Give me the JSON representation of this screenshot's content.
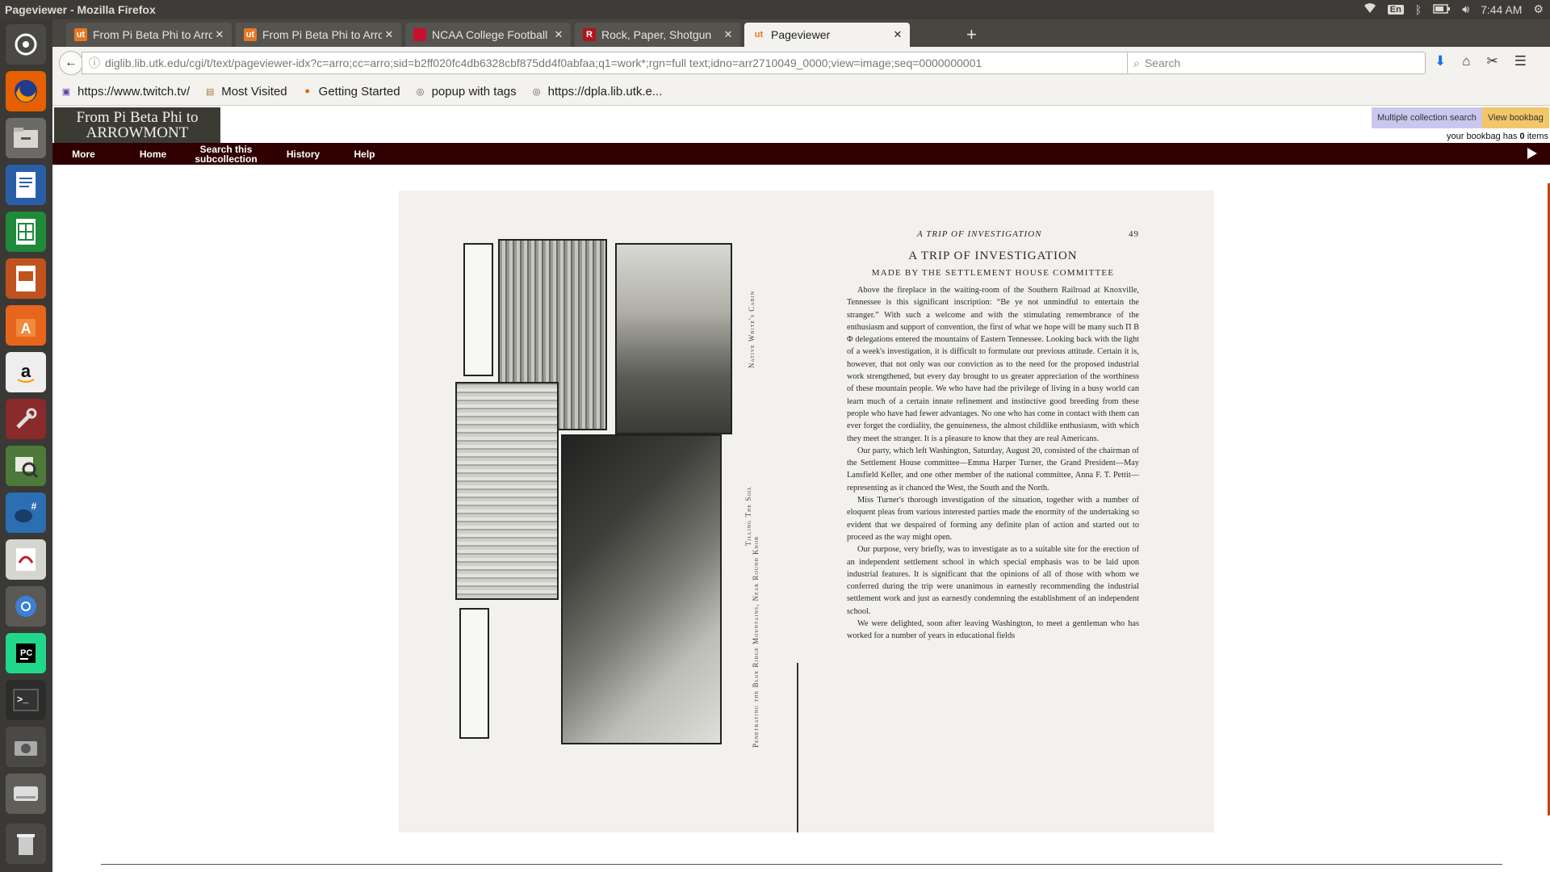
{
  "system": {
    "window_title": "Pageviewer - Mozilla Firefox",
    "keyboard": "En",
    "clock": "7:44 AM"
  },
  "browser": {
    "tabs": [
      {
        "label": "From Pi Beta Phi to Arrowmont",
        "icon": "ut-favicon"
      },
      {
        "label": "From Pi Beta Phi to Arrowmont",
        "icon": "ut-favicon"
      },
      {
        "label": "NCAA College Football",
        "icon": "ncaa-favicon"
      },
      {
        "label": "Rock, Paper, Shotgun",
        "icon": "rps-favicon"
      },
      {
        "label": "Pageviewer",
        "icon": "ut-favicon",
        "active": true
      }
    ],
    "url": "diglib.lib.utk.edu/cgi/t/text/pageviewer-idx?c=arro;cc=arro;sid=b2ff020fc4db6328cbf875dd4f0abfaa;q1=work*;rgn=full text;idno=arr2710049_0000;view=image;seq=0000000001",
    "search_placeholder": "Search",
    "bookmarks": [
      {
        "label": "https://www.twitch.tv/",
        "icon": "twitch-icon"
      },
      {
        "label": "Most Visited",
        "icon": "folder-icon"
      },
      {
        "label": "Getting Started",
        "icon": "firefox-icon"
      },
      {
        "label": "popup with tags",
        "icon": "globe-icon"
      },
      {
        "label": "https://dpla.lib.utk.e...",
        "icon": "globe-icon"
      }
    ]
  },
  "site": {
    "logo_line1": "From Pi Beta Phi to",
    "logo_line2": "ARROWMONT",
    "multi_search": "Multiple collection search",
    "view_bookbag": "View bookbag",
    "bookbag_prefix": "your bookbag has ",
    "bookbag_count": "0",
    "bookbag_suffix": " items",
    "menu": [
      "More",
      "Home",
      "Search this subcollection",
      "History",
      "Help"
    ]
  },
  "scan": {
    "captions": [
      "Native White's Cabin",
      "Tilling The Soil",
      "Penetrating the Blue Ridge Mountains, Near Round Knob"
    ],
    "running_head": "A TRIP OF INVESTIGATION",
    "page_number": "49",
    "title": "A TRIP OF INVESTIGATION",
    "subtitle": "MADE BY THE SETTLEMENT HOUSE COMMITTEE",
    "paragraphs": [
      "Above the fireplace in the waiting-room of the Southern Railroad at Knoxville, Tennessee is this significant inscription: “Be ye not unmindful to entertain the stranger.” With such a welcome and with the stimulating remembrance of the enthusiasm and support of convention, the first of what we hope will be many such Π Β Φ delegations entered the mountains of Eastern Tennessee. Looking back with the light of a week's investigation, it is difficult to formulate our previous attitude. Certain it is, however, that not only was our conviction as to the need for the proposed industrial work strengthened, but every day brought to us greater appreciation of the worthiness of these mountain people. We who have had the privilege of living in a busy world can learn much of a certain innate refinement and instinctive good breeding from these people who have had fewer advantages. No one who has come in contact with them can ever forget the cordiality, the genuineness, the almost childlike enthusiasm, with which they meet the stranger. It is a pleasure to know that they are real Americans.",
      "Our party, which left Washington, Saturday, August 20, consisted of the chairman of the Settlement House committee—Emma Harper Turner, the Grand President—May Lansfield Keller, and one other member of the national committee, Anna F. T. Pettit—representing as it chanced the West, the South and the North.",
      "Miss Turner's thorough investigation of the situation, together with a number of eloquent pleas from various interested parties made the enormity of the undertaking so evident that we despaired of forming any definite plan of action and started out to proceed as the way might open.",
      "Our purpose, very briefly, was to investigate as to a suitable site for the erection of an independent settlement school in which special emphasis was to be laid upon industrial features. It is significant that the opinions of all of those with whom we conferred during the trip were unanimous in earnestly recommending the industrial settlement work and just as earnestly condemning the establishment of an independent school.",
      "We were delighted, soon after leaving Washington, to meet a gentleman who has worked for a number of years in educational fields"
    ]
  },
  "colors": {
    "menubar": "#300000",
    "bookbag_button": "#f3c66a",
    "multisearch_button": "#c9c7ee",
    "scrollbar": "#c9420e"
  }
}
